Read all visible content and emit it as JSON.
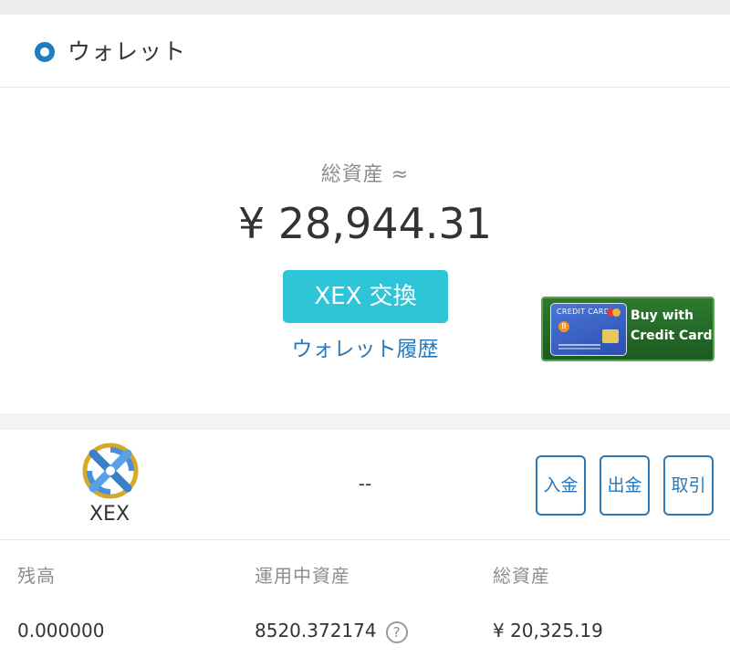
{
  "header": {
    "title": "ウォレット",
    "icon": "wallet-ring-icon"
  },
  "summary": {
    "total_label": "総資産 ≈",
    "total_value": "¥ 28,944.31",
    "exchange_button": "XEX 交換",
    "history_link": "ウォレット履歴"
  },
  "banner": {
    "card_text": "CREDIT CARD",
    "line1": "Buy with",
    "line2": "Credit Card"
  },
  "asset": {
    "name": "XEX",
    "middle_value": "--",
    "actions": {
      "deposit": "入金",
      "withdraw": "出金",
      "trade": "取引"
    }
  },
  "stats": {
    "balance_label": "残高",
    "balance_value": "0.000000",
    "staked_label": "運用中資産",
    "staked_value": "8520.372174",
    "total_label": "総資産",
    "total_value": "¥ 20,325.19"
  },
  "colors": {
    "accent_blue": "#1f7cc1",
    "link_blue": "#2a78b8",
    "exchange_button": "#2ec5d9",
    "banner_green": "#2e7a2d"
  }
}
